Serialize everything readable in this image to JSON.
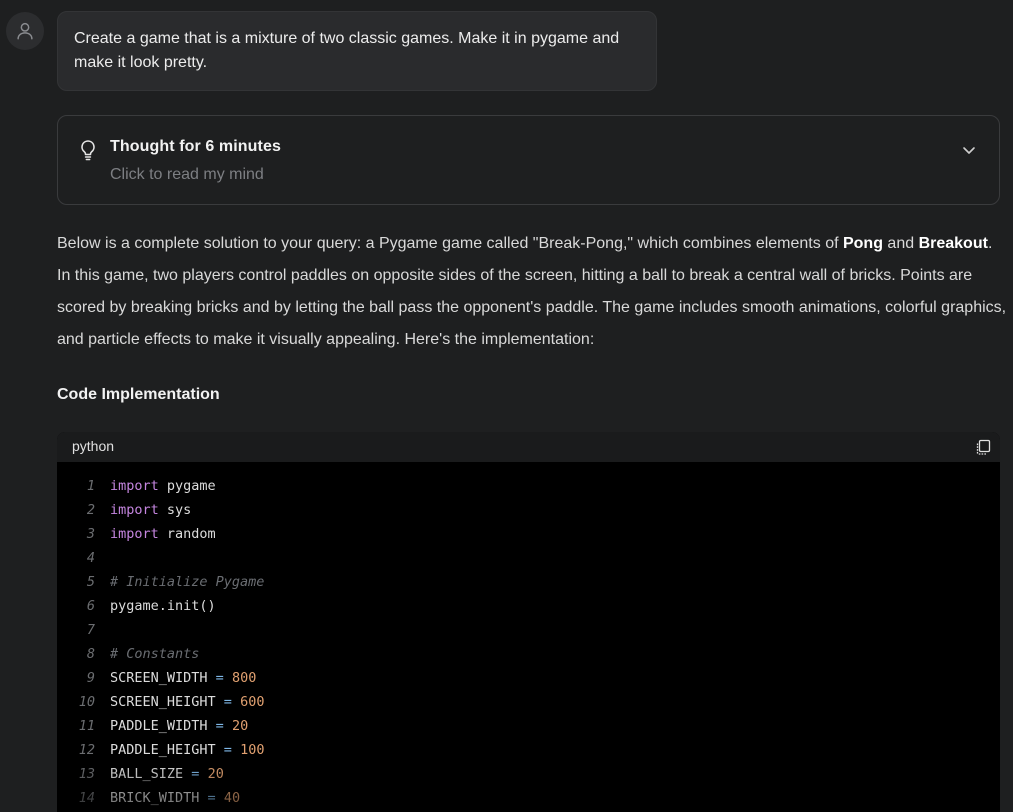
{
  "user_message": {
    "text": "Create a game that is a mixture of two classic games. Make it in pygame and make it look pretty."
  },
  "thought": {
    "title": "Thought for 6 minutes",
    "subtitle": "Click to read my mind"
  },
  "answer": {
    "part1": "Below is a complete solution to your query: a Pygame game called \"Break-Pong,\" which combines elements of ",
    "bold1": "Pong",
    "part2": " and ",
    "bold2": "Breakout",
    "part3": ". In this game, two players control paddles on opposite sides of the screen, hitting a ball to break a central wall of bricks. Points are scored by breaking bricks and by letting the ball pass the opponent's paddle. The game includes smooth animations, colorful graphics, and particle effects to make it visually appealing. Here's the implementation:"
  },
  "section_heading": "Code Implementation",
  "code": {
    "language": "python",
    "lines": [
      {
        "n": "1",
        "tokens": [
          {
            "t": "import",
            "c": "kw"
          },
          {
            "t": " pygame",
            "c": ""
          }
        ]
      },
      {
        "n": "2",
        "tokens": [
          {
            "t": "import",
            "c": "kw"
          },
          {
            "t": " sys",
            "c": ""
          }
        ]
      },
      {
        "n": "3",
        "tokens": [
          {
            "t": "import",
            "c": "kw"
          },
          {
            "t": " random",
            "c": ""
          }
        ]
      },
      {
        "n": "4",
        "tokens": []
      },
      {
        "n": "5",
        "tokens": [
          {
            "t": "# Initialize Pygame",
            "c": "cm"
          }
        ]
      },
      {
        "n": "6",
        "tokens": [
          {
            "t": "pygame.init()",
            "c": ""
          }
        ]
      },
      {
        "n": "7",
        "tokens": []
      },
      {
        "n": "8",
        "tokens": [
          {
            "t": "# Constants",
            "c": "cm"
          }
        ]
      },
      {
        "n": "9",
        "tokens": [
          {
            "t": "SCREEN_WIDTH ",
            "c": ""
          },
          {
            "t": "=",
            "c": "op"
          },
          {
            "t": " ",
            "c": ""
          },
          {
            "t": "800",
            "c": "num"
          }
        ]
      },
      {
        "n": "10",
        "tokens": [
          {
            "t": "SCREEN_HEIGHT ",
            "c": ""
          },
          {
            "t": "=",
            "c": "op"
          },
          {
            "t": " ",
            "c": ""
          },
          {
            "t": "600",
            "c": "num"
          }
        ]
      },
      {
        "n": "11",
        "tokens": [
          {
            "t": "PADDLE_WIDTH ",
            "c": ""
          },
          {
            "t": "=",
            "c": "op"
          },
          {
            "t": " ",
            "c": ""
          },
          {
            "t": "20",
            "c": "num"
          }
        ]
      },
      {
        "n": "12",
        "tokens": [
          {
            "t": "PADDLE_HEIGHT ",
            "c": ""
          },
          {
            "t": "=",
            "c": "op"
          },
          {
            "t": " ",
            "c": ""
          },
          {
            "t": "100",
            "c": "num"
          }
        ]
      },
      {
        "n": "13",
        "tokens": [
          {
            "t": "BALL_SIZE ",
            "c": ""
          },
          {
            "t": "=",
            "c": "op"
          },
          {
            "t": " ",
            "c": ""
          },
          {
            "t": "20",
            "c": "num"
          }
        ]
      },
      {
        "n": "14",
        "tokens": [
          {
            "t": "BRICK_WIDTH ",
            "c": ""
          },
          {
            "t": "=",
            "c": "op"
          },
          {
            "t": " ",
            "c": ""
          },
          {
            "t": "40",
            "c": "num"
          }
        ]
      }
    ]
  },
  "icons": {
    "avatar": "user-icon",
    "thought": "lightbulb-icon",
    "expand": "chevron-down-icon",
    "copy": "copy-icon"
  },
  "colors": {
    "background": "#1e1f20",
    "bubble": "#2a2b2d",
    "code_bg": "#000000",
    "keyword": "#c586e0",
    "number": "#e0a070",
    "comment": "#6a6d72"
  }
}
